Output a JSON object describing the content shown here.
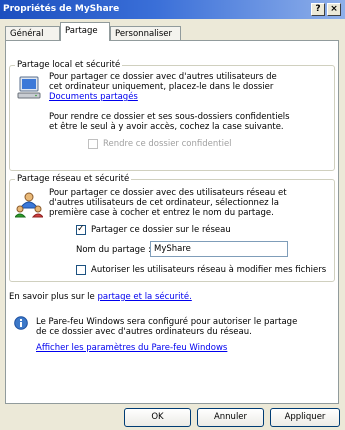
{
  "window": {
    "title": "Propriétés de MyShare",
    "help_label": "?",
    "close_label": "×"
  },
  "tabs": [
    {
      "label": "Général"
    },
    {
      "label": "Partage"
    },
    {
      "label": "Personnaliser"
    }
  ],
  "local_group": {
    "legend": "Partage local et sécurité",
    "desc_lines": [
      "Pour partager ce dossier avec d'autres utilisateurs de",
      "cet ordinateur uniquement, placez-le dans le dossier"
    ],
    "shared_docs_link": "Documents partagés",
    "private_lines": [
      "Pour rendre ce dossier et ses sous-dossiers confidentiels",
      "et être le seul à y avoir accès, cochez la case suivante."
    ],
    "private_checkbox_label": "Rendre ce dossier confidentiel",
    "private_checked": false
  },
  "network_group": {
    "legend": "Partage réseau et sécurité",
    "desc_lines": [
      "Pour partager ce dossier avec des utilisateurs réseau et",
      "d'autres utilisateurs de cet ordinateur, sélectionnez la",
      "première case à cocher et entrez le nom du partage."
    ],
    "share_checkbox_label": "Partager ce dossier sur le réseau",
    "share_checked": true,
    "share_name_label": "Nom du partage :",
    "share_name_value": "MyShare",
    "allow_modify_label": "Autoriser les utilisateurs réseau à modifier mes fichiers",
    "allow_modify_checked": false
  },
  "more_info": {
    "prefix": "En savoir plus sur le",
    "link": "partage et la sécurité."
  },
  "firewall": {
    "lines": [
      "Le Pare-feu Windows sera configuré pour autoriser le partage",
      "de ce dossier avec d'autres ordinateurs du réseau."
    ],
    "settings_link": "Afficher les paramètres du Pare-feu Windows"
  },
  "buttons": {
    "ok": "OK",
    "cancel": "Annuler",
    "apply": "Appliquer"
  }
}
